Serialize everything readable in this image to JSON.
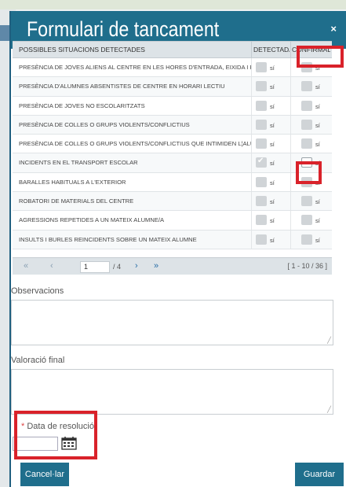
{
  "modal": {
    "title": "Formulari de tancament",
    "close_icon": "close-icon"
  },
  "grid": {
    "headers": [
      "POSSIBLES SITUACIONS DETECTADES",
      "DETECTADA",
      "CONFIRMADA"
    ],
    "rows": [
      {
        "label": "PRESÈNCIA DE JOVES ALIENS AL CENTRE EN LES HORES D'ENTRADA, EIXIDA I PATIS",
        "detectada": "sí",
        "confirmada": "sí",
        "det_checked": false,
        "conf_checked": false
      },
      {
        "label": "PRESÈNCIA D'ALUMNES ABSENTISTES DE CENTRE EN HORARI LECTIU",
        "detectada": "sí",
        "confirmada": "sí",
        "det_checked": false,
        "conf_checked": false
      },
      {
        "label": "PRESÈNCIA DE JOVES NO ESCOLARITZATS",
        "detectada": "sí",
        "confirmada": "sí",
        "det_checked": false,
        "conf_checked": false
      },
      {
        "label": "PRESÈNCIA DE COLLES O GRUPS VIOLENTS/CONFLICTIUS",
        "detectada": "sí",
        "confirmada": "sí",
        "det_checked": false,
        "conf_checked": false
      },
      {
        "label": "PRESÈNCIA DE COLLES O GRUPS VIOLENTS/CONFLICTIUS QUE INTIMIDEN L¦ALUMNAT",
        "detectada": "sí",
        "confirmada": "sí",
        "det_checked": false,
        "conf_checked": false
      },
      {
        "label": "INCIDENTS EN EL TRANSPORT ESCOLAR",
        "detectada": "sí",
        "confirmada": "sí",
        "det_checked": true,
        "conf_checked": false
      },
      {
        "label": "BARALLES HABITUALS A L'EXTERIOR",
        "detectada": "sí",
        "confirmada": "sí",
        "det_checked": false,
        "conf_checked": false
      },
      {
        "label": "ROBATORI DE MATERIALS DEL CENTRE",
        "detectada": "sí",
        "confirmada": "sí",
        "det_checked": false,
        "conf_checked": false
      },
      {
        "label": "AGRESSIONS REPETIDES A UN MATEIX ALUMNE/A",
        "detectada": "sí",
        "confirmada": "sí",
        "det_checked": false,
        "conf_checked": false
      },
      {
        "label": "INSULTS I BURLES REINCIDENTS SOBRE UN MATEIX ALUMNE",
        "detectada": "sí",
        "confirmada": "sí",
        "det_checked": false,
        "conf_checked": false
      }
    ]
  },
  "pager": {
    "first": "«",
    "prev": "‹",
    "page": "1",
    "total": "/ 4",
    "next": "›",
    "last": "»",
    "range": "[ 1 - 10 / 36 ]"
  },
  "fields": {
    "observacions_label": "Observacions",
    "valoracio_label": "Valoració final",
    "data_label": "Data de resolució",
    "required_mark": "*"
  },
  "buttons": {
    "cancel": "Cancel·lar",
    "save": "Guardar"
  },
  "colors": {
    "header": "#1f6e8c",
    "highlight": "#d9222a"
  }
}
